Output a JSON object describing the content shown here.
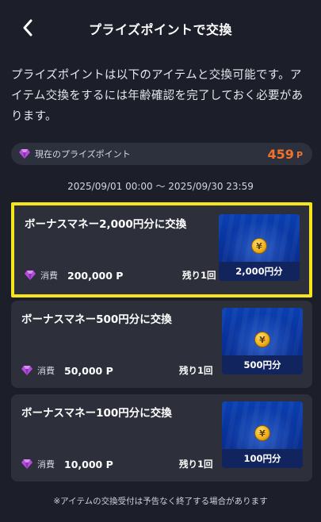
{
  "header": {
    "title": "プライズポイントで交換",
    "back_icon": "chevron-left-icon"
  },
  "description": "プライズポイントは以下のアイテムと交換可能です。アイテム交換をするには年齢確認を完了しておく必要があります。",
  "points": {
    "label": "現在のプライズポイント",
    "value": "459",
    "unit": "P",
    "gem_icon": "gem-icon",
    "accent": "#f2722b"
  },
  "period": "2025/09/01 00:00 ～ 2025/09/30 23:59",
  "items": [
    {
      "name": "ボーナスマネー2,000円分に交換",
      "cost_label": "消費",
      "cost": "200,000 P",
      "remaining": "残り1回",
      "thumb_label": "2,000円分",
      "coin_symbol": "¥",
      "selected": true
    },
    {
      "name": "ボーナスマネー500円分に交換",
      "cost_label": "消費",
      "cost": "50,000 P",
      "remaining": "残り1回",
      "thumb_label": "500円分",
      "coin_symbol": "¥",
      "selected": false
    },
    {
      "name": "ボーナスマネー100円分に交換",
      "cost_label": "消費",
      "cost": "10,000 P",
      "remaining": "残り1回",
      "thumb_label": "100円分",
      "coin_symbol": "¥",
      "selected": false
    }
  ],
  "footnote": "※アイテムの交換受付は予告なく終了する場合があります",
  "colors": {
    "background": "#1c1f2a",
    "card": "#2d303b",
    "highlight": "#f5e51a",
    "gem": "#b14dd8"
  }
}
